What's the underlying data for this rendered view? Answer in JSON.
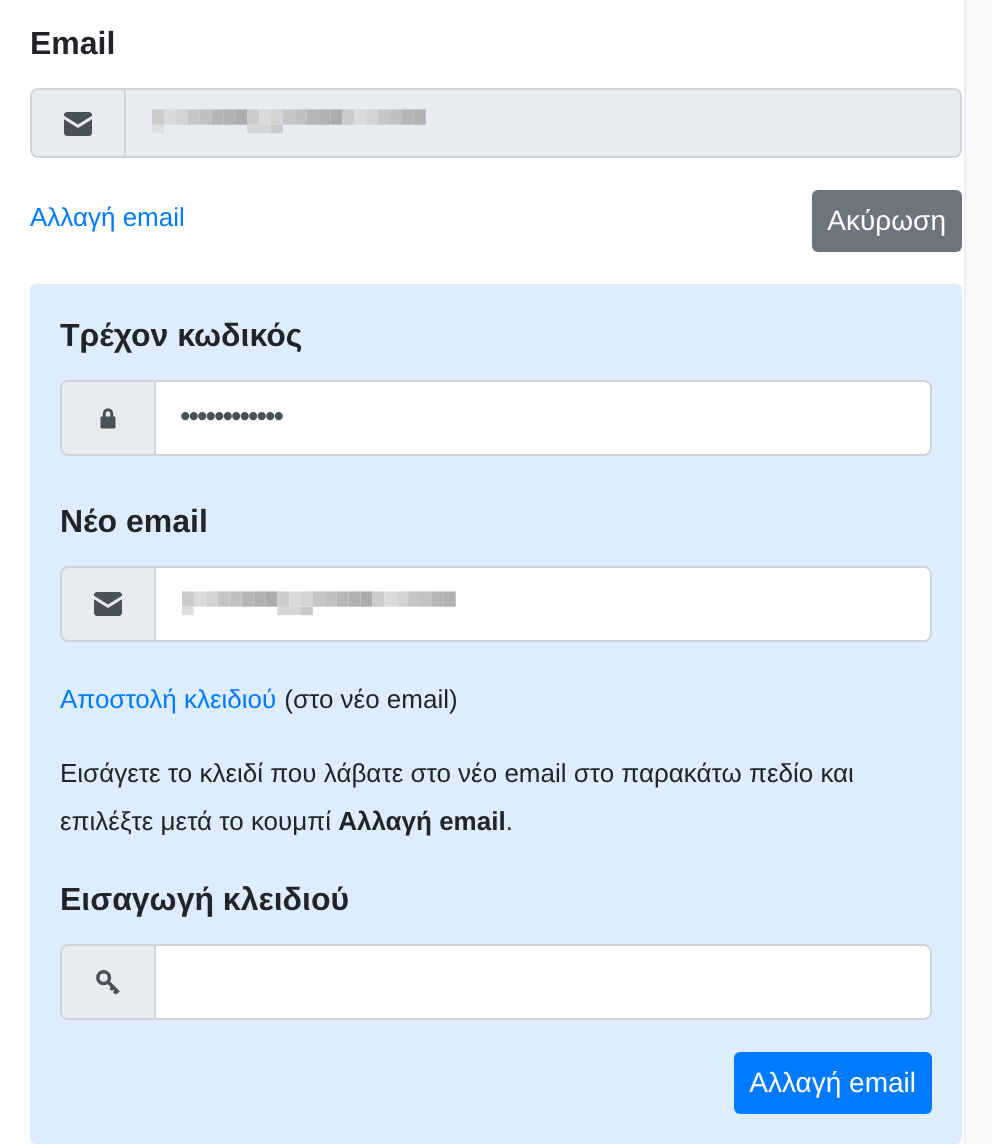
{
  "email_section": {
    "label": "Email",
    "field": {
      "kind": "envelope",
      "disabled": true,
      "redacted": true
    },
    "change_link": "Αλλαγή email",
    "cancel_button": "Ακύρωση"
  },
  "change_panel": {
    "current_password": {
      "label": "Τρέχον κωδικός",
      "field": {
        "kind": "lock",
        "disabled": false,
        "value": "••••••••••••"
      }
    },
    "new_email": {
      "label": "Νέο email",
      "field": {
        "kind": "envelope",
        "disabled": false,
        "redacted": true
      }
    },
    "send_key": {
      "link": "Αποστολή κλειδιού",
      "note": "(στο νέο email)"
    },
    "instructions": "Εισάγετε το κλειδί που λάβατε στο νέο email στο παρακάτω πεδίο και επιλέξτε μετά το κουμπί **Αλλαγή email**.",
    "key_entry": {
      "label": "Εισαγωγή κλειδιού",
      "field": {
        "kind": "key",
        "disabled": false
      }
    },
    "submit_button": "Αλλαγή email"
  }
}
